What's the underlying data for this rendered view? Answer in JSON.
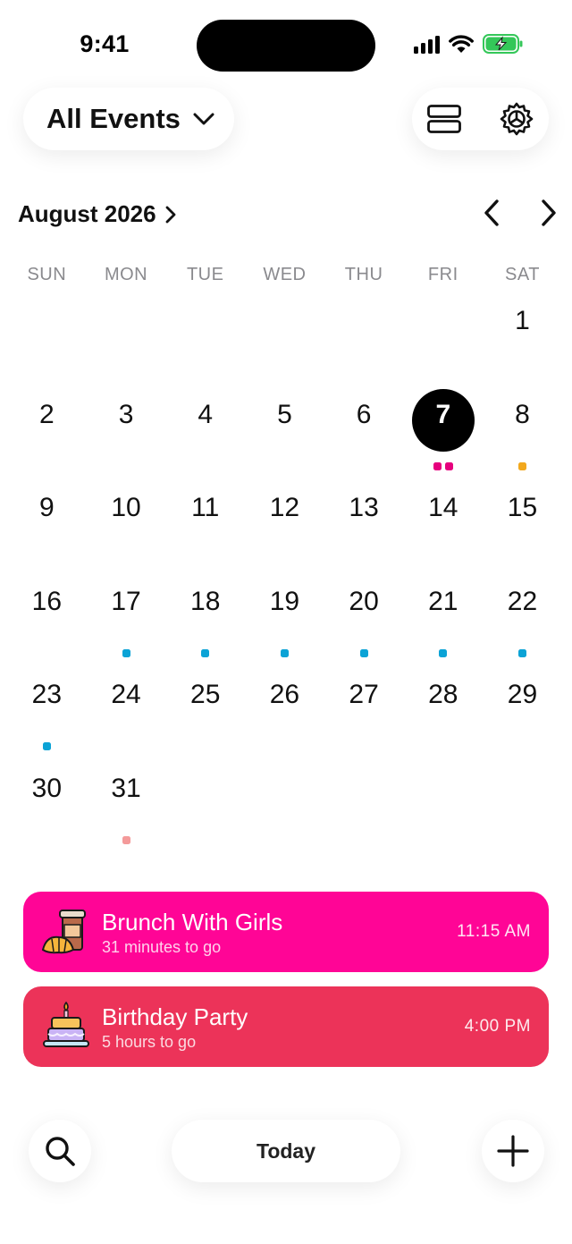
{
  "status_bar": {
    "time": "9:41"
  },
  "header": {
    "filter_label": "All Events"
  },
  "calendar": {
    "month_title": "August 2026",
    "weekdays": [
      "SUN",
      "MON",
      "TUE",
      "WED",
      "THU",
      "FRI",
      "SAT"
    ],
    "days": [
      {
        "d": null
      },
      {
        "d": null
      },
      {
        "d": null
      },
      {
        "d": null
      },
      {
        "d": null
      },
      {
        "d": null
      },
      {
        "d": "1"
      },
      {
        "d": "2"
      },
      {
        "d": "3"
      },
      {
        "d": "4"
      },
      {
        "d": "5"
      },
      {
        "d": "6"
      },
      {
        "d": "7",
        "today": true,
        "dots": [
          "#e6007e",
          "#e6007e"
        ]
      },
      {
        "d": "8",
        "dots": [
          "#f2a81d"
        ]
      },
      {
        "d": "9"
      },
      {
        "d": "10"
      },
      {
        "d": "11"
      },
      {
        "d": "12"
      },
      {
        "d": "13"
      },
      {
        "d": "14"
      },
      {
        "d": "15"
      },
      {
        "d": "16"
      },
      {
        "d": "17",
        "dots": [
          "#0ba3d6"
        ]
      },
      {
        "d": "18",
        "dots": [
          "#0ba3d6"
        ]
      },
      {
        "d": "19",
        "dots": [
          "#0ba3d6"
        ]
      },
      {
        "d": "20",
        "dots": [
          "#0ba3d6"
        ]
      },
      {
        "d": "21",
        "dots": [
          "#0ba3d6"
        ]
      },
      {
        "d": "22",
        "dots": [
          "#0ba3d6"
        ]
      },
      {
        "d": "23",
        "dots": [
          "#0ba3d6"
        ]
      },
      {
        "d": "24"
      },
      {
        "d": "25"
      },
      {
        "d": "26"
      },
      {
        "d": "27"
      },
      {
        "d": "28"
      },
      {
        "d": "29"
      },
      {
        "d": "30"
      },
      {
        "d": "31",
        "dots": [
          "#f49a9a"
        ]
      }
    ]
  },
  "events": [
    {
      "title": "Brunch With Girls",
      "subtitle": "31 minutes to go",
      "time": "11:15 AM",
      "color": "#ff0596",
      "icon": "coffee-croissant-icon"
    },
    {
      "title": "Birthday Party",
      "subtitle": "5 hours to go",
      "time": "4:00 PM",
      "color": "#ec3359",
      "icon": "birthday-cake-icon"
    }
  ],
  "bottom_bar": {
    "today_label": "Today"
  }
}
